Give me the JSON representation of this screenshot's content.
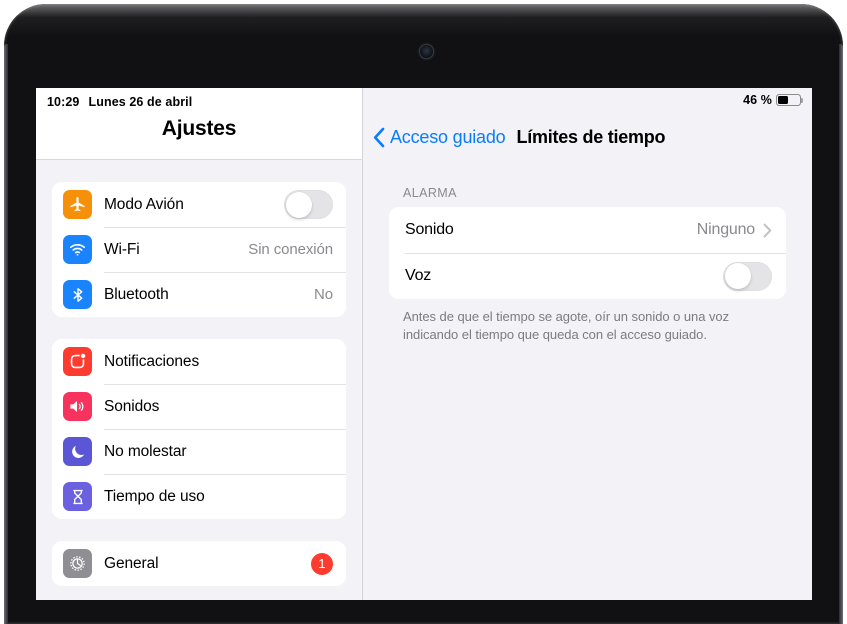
{
  "device": {
    "camera_icon": "front-camera",
    "frame_color": "#111113"
  },
  "status_bar": {
    "time": "10:29",
    "date": "Lunes 26 de abril",
    "battery_percent_label": "46 %",
    "battery_level": 46,
    "battery_icon": "battery-icon"
  },
  "sidebar": {
    "title": "Ajustes",
    "groups": [
      {
        "rows": [
          {
            "icon": "airplane-icon",
            "icon_color": "#f79009",
            "label": "Modo Avión",
            "control": "toggle",
            "toggle_on": false
          },
          {
            "icon": "wifi-icon",
            "icon_color": "#1a84ff",
            "label": "Wi-Fi",
            "control": "value",
            "value": "Sin conexión"
          },
          {
            "icon": "bluetooth-icon",
            "icon_color": "#1a84ff",
            "label": "Bluetooth",
            "control": "value",
            "value": "No"
          }
        ]
      },
      {
        "rows": [
          {
            "icon": "notifications-icon",
            "icon_color": "#ff3b30",
            "label": "Notificaciones",
            "control": "none"
          },
          {
            "icon": "sounds-icon",
            "icon_color": "#f7335d",
            "label": "Sonidos",
            "control": "none"
          },
          {
            "icon": "do-not-disturb-icon",
            "icon_color": "#5a56d6",
            "label": "No molestar",
            "control": "none"
          },
          {
            "icon": "screen-time-icon",
            "icon_color": "#6b61e0",
            "label": "Tiempo de uso",
            "control": "none"
          }
        ]
      },
      {
        "rows": [
          {
            "icon": "gear-icon",
            "icon_color": "#8e8e93",
            "label": "General",
            "control": "badge",
            "badge": "1"
          }
        ]
      }
    ]
  },
  "detail": {
    "back_label": "Acceso guiado",
    "back_icon": "chevron-left-icon",
    "title": "Límites de tiempo",
    "section_header": "ALARMA",
    "rows": [
      {
        "label": "Sonido",
        "control": "disclosure",
        "value": "Ninguno",
        "disclosure_icon": "chevron-right-icon"
      },
      {
        "label": "Voz",
        "control": "toggle",
        "toggle_on": false
      }
    ],
    "footer": "Antes de que el tiempo se agote, oír un sonido o una voz indicando el tiempo que queda con el acceso guiado."
  },
  "colors": {
    "accent": "#0a7cff",
    "badge_red": "#ff3b30",
    "background": "#f2f2f7",
    "card": "#ffffff",
    "secondary_text": "#8a8a8e"
  }
}
